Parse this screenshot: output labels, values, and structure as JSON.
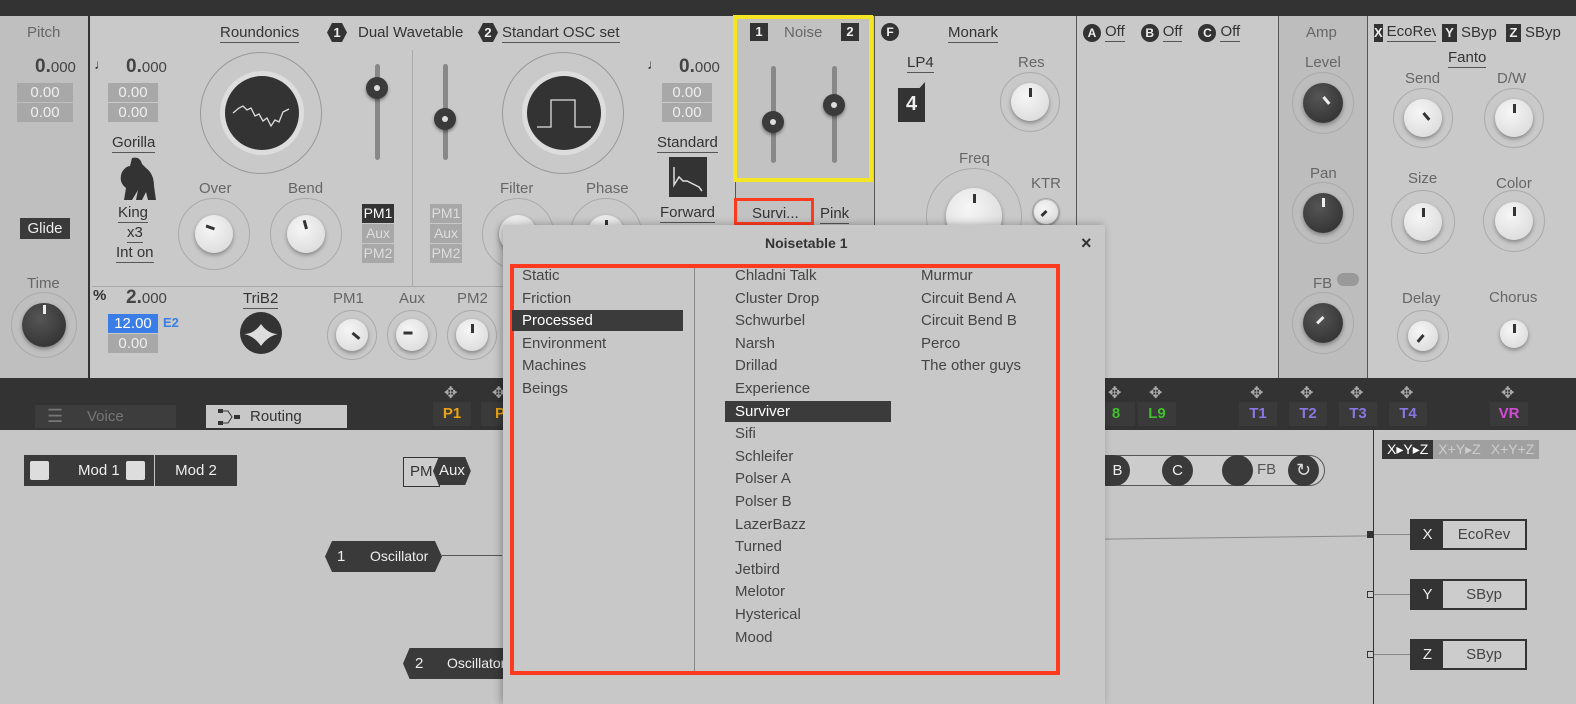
{
  "pitch": {
    "title": "Pitch",
    "value": "0.",
    "value_dec": "000",
    "fine1": "0.00",
    "fine2": "0.00",
    "glide": "Glide",
    "time": "Time"
  },
  "osc1": {
    "wavetable": "Roundonics",
    "slot1": "1",
    "slot1_label": "Dual Wavetable",
    "slot2": "2",
    "slot2_label": "Standart OSC set",
    "pitch": "0.",
    "pitch_dec": "000",
    "fine1": "0.00",
    "fine2": "0.00",
    "mode": "Gorilla",
    "mode_name": "King",
    "mode_mult": "x3",
    "mode_int": "Int on",
    "over": "Over",
    "bend": "Bend",
    "pm1": "PM1",
    "aux": "Aux",
    "pm2": "PM2"
  },
  "osc2": {
    "pitch": "0.",
    "pitch_dec": "000",
    "fine1": "0.00",
    "fine2": "0.00",
    "mode": "Standard",
    "direction": "Forward",
    "filter": "Filter",
    "phase": "Phase",
    "pm1": "PM1",
    "aux": "Aux",
    "pm2": "PM2"
  },
  "phasemod": {
    "ratio": "2.",
    "ratio_dec": "000",
    "semitone": "12.00",
    "note": "E2",
    "fine": "0.00",
    "shape": "TriB2",
    "pm1": "PM1",
    "aux": "Aux",
    "pm2": "PM2"
  },
  "noise": {
    "title": "Noise",
    "slot1": "1",
    "slot2": "2",
    "type1": "Survi...",
    "type2": "Pink"
  },
  "filter": {
    "badge": "F",
    "name": "Monark",
    "mode": "LP4",
    "mode_num": "4",
    "res": "Res",
    "freq": "Freq",
    "ktr": "KTR"
  },
  "inserts": [
    {
      "badge": "A",
      "label": "Off"
    },
    {
      "badge": "B",
      "label": "Off"
    },
    {
      "badge": "C",
      "label": "Off"
    }
  ],
  "amp": {
    "title": "Amp",
    "level": "Level",
    "pan": "Pan",
    "fb": "FB"
  },
  "fx": {
    "slots": [
      {
        "badge": "X",
        "label": "EcoRev"
      },
      {
        "badge": "Y",
        "label": "SByp"
      },
      {
        "badge": "Z",
        "label": "SByp"
      }
    ],
    "preset": "Fanto",
    "send": "Send",
    "dw": "D/W",
    "size": "Size",
    "color": "Color",
    "delay": "Delay",
    "chorus": "Chorus"
  },
  "tabs": {
    "voice": "Voice",
    "routing": "Routing"
  },
  "mod_tags": [
    {
      "label": "P1",
      "color": "#e8a317"
    },
    {
      "label": "P",
      "color": "#e8a317"
    },
    {
      "label": "8",
      "color": "#3fbf2a"
    },
    {
      "label": "L9",
      "color": "#3fbf2a"
    },
    {
      "label": "T1",
      "color": "#8a76e0"
    },
    {
      "label": "T2",
      "color": "#8a76e0"
    },
    {
      "label": "T3",
      "color": "#8a76e0"
    },
    {
      "label": "T4",
      "color": "#8a76e0"
    },
    {
      "label": "VR",
      "color": "#d24bd6"
    }
  ],
  "routing": {
    "mod1": "Mod 1",
    "mod2": "Mod 2",
    "pm": "PM",
    "aux": "Aux",
    "osc1_num": "1",
    "osc1": "Oscillator",
    "osc2_num": "2",
    "osc2": "Oscillator",
    "b": "B",
    "c": "C",
    "fb": "FB",
    "fx_modes": [
      "X▸Y▸Z",
      "X+Y▸Z",
      "X+Y+Z"
    ],
    "fx_chain": [
      {
        "slot": "X",
        "name": "EcoRev"
      },
      {
        "slot": "Y",
        "name": "SByp"
      },
      {
        "slot": "Z",
        "name": "SByp"
      }
    ]
  },
  "popup": {
    "title": "Noisetable 1",
    "close": "×",
    "categories": [
      "Static",
      "Friction",
      "Processed",
      "Environment",
      "Machines",
      "Beings"
    ],
    "selected_category": "Processed",
    "col1": [
      "Chladni Talk",
      "Cluster Drop",
      "Schwurbel",
      "Narsh",
      "Drillad",
      "Experience",
      "Surviver",
      "Sifi",
      "Schleifer",
      "Polser A",
      "Polser B",
      "LazerBazz",
      "Turned",
      "Jetbird",
      "Melotor",
      "Hysterical",
      "Mood"
    ],
    "col2": [
      "Murmur",
      "Circuit Bend A",
      "Circuit Bend B",
      "Perco",
      "The other guys"
    ],
    "selected_item": "Surviver"
  },
  "annotations": {
    "highlight_color": "#f5e625",
    "callout_color": "#ff3b1f"
  }
}
